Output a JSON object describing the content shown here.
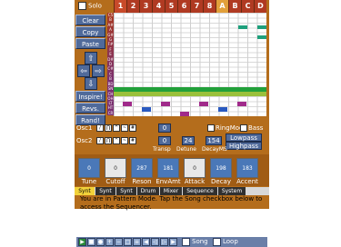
{
  "header": {
    "solo_label": "Solo",
    "pattern_tabs": [
      "1",
      "2",
      "3",
      "4",
      "5",
      "6",
      "7",
      "8",
      "A",
      "B",
      "C",
      "D"
    ]
  },
  "sidebar": {
    "buttons": [
      "Clear",
      "Copy",
      "Paste"
    ],
    "actions": [
      "Inspire!",
      "Revs.",
      "Rand!"
    ]
  },
  "keys": [
    "C5",
    "B",
    "A#",
    "A",
    "G#",
    "G",
    "F#",
    "F",
    "E",
    "D#",
    "D",
    "C#",
    "C",
    "B",
    "A#"
  ],
  "drums": [
    "BD",
    "SN",
    "CH",
    "OH",
    "LT",
    "HT",
    "CR"
  ],
  "osc": {
    "osc1_label": "Osc1",
    "osc2_label": "Osc2",
    "ringmod_label": "RingMod",
    "bass_label": "Bass",
    "transp_label": "Transp",
    "detune_label": "Detune",
    "decay_label": "DecayMS",
    "transp_value": "0",
    "detune_value": "0",
    "osc2_transp": "0",
    "osc2_detune": "24",
    "decay_value": "154",
    "lowpass_label": "Lowpass",
    "highpass_label": "Highpass"
  },
  "knobs": [
    {
      "label": "Tune",
      "value": "0"
    },
    {
      "label": "Cutoff",
      "value": "0"
    },
    {
      "label": "Reson",
      "value": "287"
    },
    {
      "label": "EnvAmt",
      "value": "181"
    },
    {
      "label": "Attack",
      "value": "0"
    },
    {
      "label": "Decay",
      "value": "198"
    },
    {
      "label": "Accent",
      "value": "183"
    }
  ],
  "bottom_tabs": [
    "Synt",
    "Synt",
    "Synt",
    "Drum",
    "Mixer",
    "Sequence",
    "System"
  ],
  "info_text": "You are in Pattern Mode. Tap the Song checkbox below to access the Sequencer.",
  "toolbar": {
    "song_label": "Song",
    "loop_label": "Loop"
  },
  "colors": {
    "app_bg": "#b46d1c",
    "button_blue": "#506a9a",
    "note_green": "#1ea07c",
    "tab_active": "#e2a03a"
  }
}
